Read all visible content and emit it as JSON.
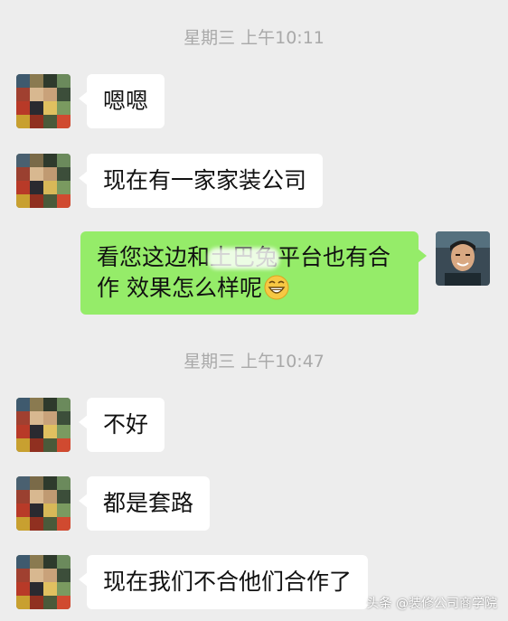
{
  "chat": {
    "timestamp_1": "星期三 上午10:11",
    "timestamp_2": "星期三 上午10:47",
    "msg_1": "嗯嗯",
    "msg_2": "现在有一家家装公司",
    "sent_part1": "看您这边和",
    "sent_blurred": "土巴兔",
    "sent_part2": "平台也有合作  效果怎么样呢",
    "msg_4": "不好",
    "msg_5": "都是套路",
    "msg_6": "现在我们不合他们合作了"
  },
  "emoji": "grin-emoji",
  "watermark": "头条 @装修公司商学院",
  "colors": {
    "background": "#ededed",
    "incoming_bubble": "#ffffff",
    "outgoing_bubble": "#95ec69",
    "timestamp_text": "#a9a9a9"
  }
}
